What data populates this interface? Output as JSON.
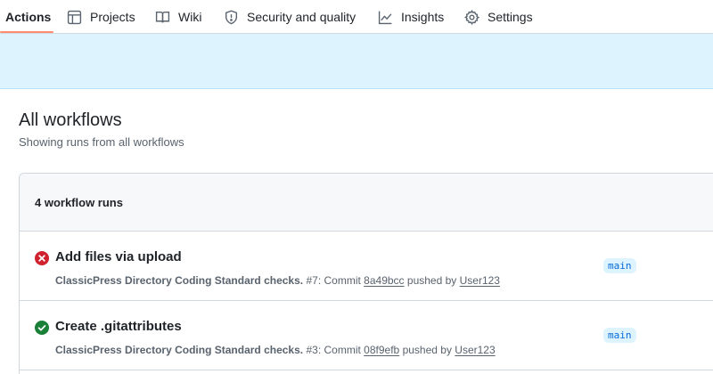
{
  "nav": {
    "tabs": [
      {
        "label": "Actions",
        "icon": "play-icon",
        "active": true
      },
      {
        "label": "Projects",
        "icon": "table-icon"
      },
      {
        "label": "Wiki",
        "icon": "book-icon"
      },
      {
        "label": "Security and quality",
        "icon": "shield-icon"
      },
      {
        "label": "Insights",
        "icon": "graph-icon"
      },
      {
        "label": "Settings",
        "icon": "gear-icon"
      }
    ]
  },
  "page": {
    "title": "All workflows",
    "subtitle": "Showing runs from all workflows"
  },
  "runs": {
    "count_label": "4 workflow runs",
    "items": [
      {
        "status": "failure",
        "title": "Add files via upload",
        "workflow": "ClassicPress Directory Coding Standard checks.",
        "run_number": "#7",
        "commit_prefix": "Commit",
        "commit": "8a49bcc",
        "pushed_by_prefix": "pushed by",
        "user": "User123",
        "branch": "main"
      },
      {
        "status": "success",
        "title": "Create .gitattributes",
        "workflow": "ClassicPress Directory Coding Standard checks.",
        "run_number": "#3",
        "commit_prefix": "Commit",
        "commit": "08f9efb",
        "pushed_by_prefix": "pushed by",
        "user": "User123",
        "branch": "main"
      }
    ]
  },
  "colors": {
    "accent_underline": "#fd8c73",
    "failure": "#cf222e",
    "success": "#1a7f37",
    "banner": "#ddf4ff",
    "branch_text": "#0969da"
  }
}
